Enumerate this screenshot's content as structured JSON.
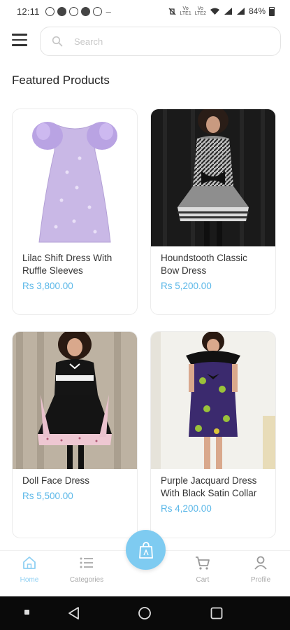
{
  "status_bar": {
    "time": "12:11",
    "net_top": "Vo",
    "net_mid": "LTE",
    "net_bot": "LTE1",
    "net2_top": "Vo",
    "net2_bot": "LTE2",
    "battery": "84%"
  },
  "search": {
    "placeholder": "Search"
  },
  "section_title": "Featured Products",
  "products": [
    {
      "name": "Lilac Shift Dress With Ruffle Sleeves",
      "price": "Rs 3,800.00"
    },
    {
      "name": "Houndstooth Classic Bow Dress",
      "price": "Rs 5,200.00"
    },
    {
      "name": "Doll Face Dress",
      "price": "Rs 5,500.00"
    },
    {
      "name": "Purple Jacquard Dress With Black Satin Collar",
      "price": "Rs 4,200.00"
    }
  ],
  "bottom_nav": {
    "home": "Home",
    "categories": "Categories",
    "cart": "Cart",
    "profile": "Profile"
  },
  "colors": {
    "accent": "#5ab7e8",
    "fab": "#7ecbf1"
  }
}
